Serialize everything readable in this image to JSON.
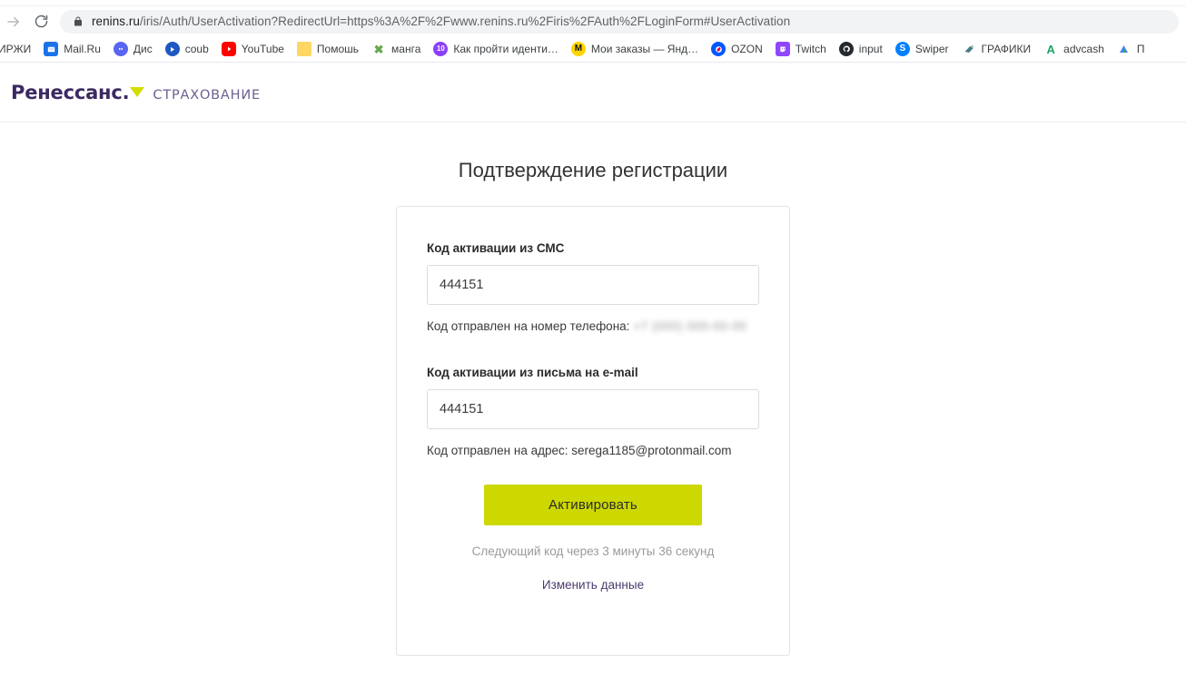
{
  "browser": {
    "nav": {
      "forward_icon": "arrow-right-icon",
      "reload_icon": "reload-icon"
    },
    "omnibox": {
      "lock_icon": "lock-icon",
      "url_host": "renins.ru",
      "url_path": "/iris/Auth/UserActivation?RedirectUrl=https%3A%2F%2Fwww.renins.ru%2Firis%2FAuth%2FLoginForm#UserActivation"
    },
    "bookmarks": [
      {
        "label": "ИРЖИ",
        "icon": "",
        "icon_bg": "transparent",
        "icon_color": "#ffffff",
        "hide_icon": true
      },
      {
        "label": "Mail.Ru",
        "icon": "✉",
        "icon_bg": "#1a73e8",
        "icon_color": "#ffffff"
      },
      {
        "label": "Дис",
        "icon": "●",
        "icon_bg": "#5865f2",
        "icon_color": "#ffffff"
      },
      {
        "label": "coub",
        "icon": "▶",
        "icon_bg": "#1f57c3",
        "icon_color": "#ffffff"
      },
      {
        "label": "YouTube",
        "icon": "▶",
        "icon_bg": "#ff0000",
        "icon_color": "#ffffff"
      },
      {
        "label": "Помошь",
        "icon": "",
        "icon_bg": "#fdd663",
        "icon_color": "#ffffff"
      },
      {
        "label": "манга",
        "icon": "✖",
        "icon_bg": "transparent",
        "icon_color": "#6aa84f"
      },
      {
        "label": "Как пройти иденти…",
        "icon": "⬤",
        "icon_bg": "#8a2be2",
        "icon_color": "#ffffff"
      },
      {
        "label": "Мои заказы — Янд…",
        "icon": "M",
        "icon_bg": "#ffd400",
        "icon_color": "#111111"
      },
      {
        "label": "OZON",
        "icon": "◉",
        "icon_bg": "#0058ff",
        "icon_color": "#ffffff"
      },
      {
        "label": "Twitch",
        "icon": "■",
        "icon_bg": "#9146ff",
        "icon_color": "#ffffff"
      },
      {
        "label": "input",
        "icon": "⬤",
        "icon_bg": "#24292e",
        "icon_color": "#ffffff"
      },
      {
        "label": "Swiper",
        "icon": "S",
        "icon_bg": "#0080ff",
        "icon_color": "#ffffff"
      },
      {
        "label": "ГРАФИКИ",
        "icon": "➤",
        "icon_bg": "transparent",
        "icon_color": "#5c8a8a"
      },
      {
        "label": "advcash",
        "icon": "A",
        "icon_bg": "transparent",
        "icon_color": "#1ea362"
      },
      {
        "label": "П",
        "icon": "▲",
        "icon_bg": "transparent",
        "icon_color": "#4285f4"
      }
    ]
  },
  "site": {
    "logo": {
      "main": "Ренессанс.",
      "triangle_icon": "triangle-down-icon",
      "sub": "СТРАХОВАНИЕ",
      "color_main": "#3b2a62",
      "color_sub": "#6d5f92",
      "color_triangle": "#d4dc00"
    }
  },
  "form": {
    "title": "Подтверждение регистрации",
    "sms": {
      "label": "Код активации из СМС",
      "value": "444151",
      "placeholder": "",
      "hint_prefix": "Код отправлен на номер телефона:",
      "hint_value": "+7 (000) 000-00-00"
    },
    "email": {
      "label": "Код активации из письма на e-mail",
      "value": "444151",
      "placeholder": "",
      "hint": "Код отправлен на адрес: serega1185@protonmail.com"
    },
    "submit_label": "Активировать",
    "submit_color": "#cdd800",
    "timer_text": "Следующий код через 3 минуты 36 секунд",
    "change_link": "Изменить данные",
    "link_color": "#4a3b6e"
  }
}
